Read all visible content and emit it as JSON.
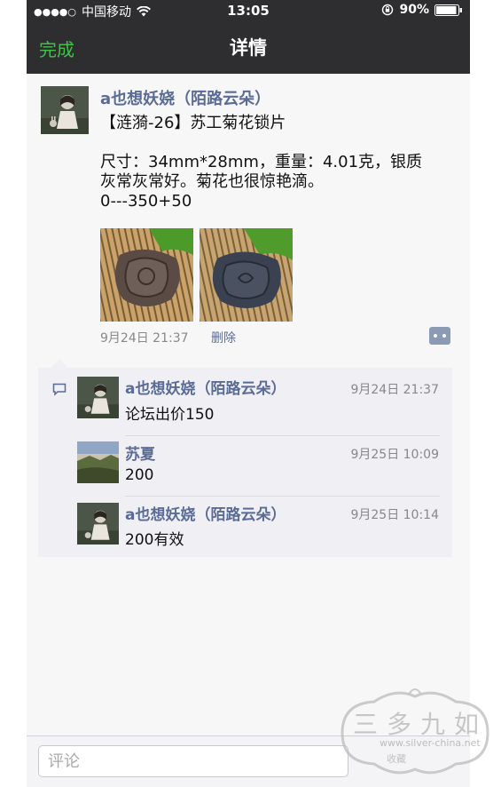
{
  "status_bar": {
    "signal_dots": "●●●●○",
    "carrier": "中国移动",
    "time": "13:05",
    "battery": "90%"
  },
  "nav": {
    "done_label": "完成",
    "title": "详情"
  },
  "post": {
    "author": "a也想妖娆（陌路云朵）",
    "lines": [
      "【涟漪-26】苏工菊花锁片",
      "",
      "尺寸：34mm*28mm，重量：4.01克，银质",
      "灰常灰常好。菊花也很惊艳滴。",
      "0---350+50"
    ],
    "time": "9月24日 21:37",
    "delete_label": "删除"
  },
  "comments": [
    {
      "author": "a也想妖娆（陌路云朵）",
      "time": "9月24日 21:37",
      "text": "论坛出价150"
    },
    {
      "author": "苏夏",
      "time": "9月25日 10:09",
      "text": "200"
    },
    {
      "author": "a也想妖娆（陌路云朵）",
      "time": "9月25日 10:14",
      "text": "200有效"
    }
  ],
  "comment_bar": {
    "placeholder": "评论"
  },
  "watermark": {
    "brand": "三多九如",
    "url": "www.silver-china.net",
    "sub": "收藏"
  },
  "colors": {
    "nav_bg": "#2e2e30",
    "accent_green": "#44c04a",
    "link_blue": "#5a6b96"
  }
}
